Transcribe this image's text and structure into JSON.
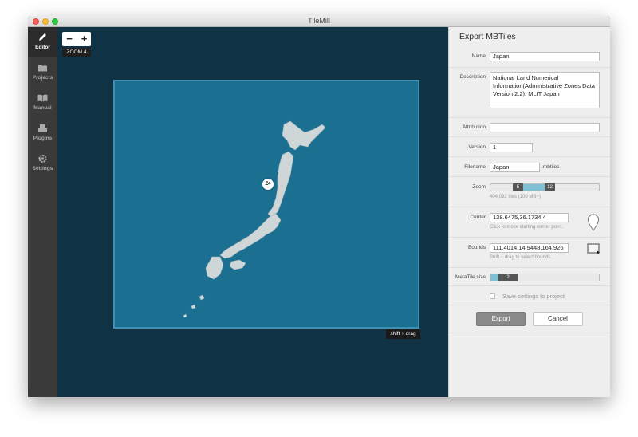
{
  "window": {
    "title": "TileMill"
  },
  "sidebar": {
    "items": [
      {
        "label": "Editor",
        "icon": "pencil-icon",
        "active": true
      },
      {
        "label": "Projects",
        "icon": "folder-icon",
        "active": false
      },
      {
        "label": "Manual",
        "icon": "book-icon",
        "active": false
      },
      {
        "label": "Plugins",
        "icon": "plugin-icon",
        "active": false
      },
      {
        "label": "Settings",
        "icon": "gear-icon",
        "active": false
      }
    ]
  },
  "map": {
    "zoom_in": "+",
    "zoom_out": "−",
    "zoom_level": "ZOOM 4",
    "marker_label": "Z4",
    "hint": "shift + drag"
  },
  "panel": {
    "title": "Export MBTiles",
    "name": {
      "label": "Name",
      "value": "Japan"
    },
    "description": {
      "label": "Description",
      "value": "National Land Numerical Information(Administrative Zones Data Version 2.2), MLIT Japan"
    },
    "attribution": {
      "label": "Attribution",
      "value": ""
    },
    "version": {
      "label": "Version",
      "value": "1"
    },
    "filename": {
      "label": "Filename",
      "value": "Japan",
      "suffix": ".mbtiles"
    },
    "zoom": {
      "label": "Zoom",
      "min": "5",
      "max": "12",
      "hint": "404,092 tiles (100 MB+)"
    },
    "center": {
      "label": "Center",
      "value": "138.6475,36.1734,4",
      "hint": "Click to move starting center point."
    },
    "bounds": {
      "label": "Bounds",
      "value": "111.4014,14.9448,164.926",
      "hint": "Shift + drag to select bounds."
    },
    "metatile": {
      "label": "MetaTile size",
      "value": "2"
    },
    "save_settings": {
      "label": "Save settings to project",
      "checked": false
    },
    "export_button": "Export",
    "cancel_button": "Cancel"
  },
  "colors": {
    "map_bg": "#0f3345",
    "bounds_fill": "#1b6f91",
    "accent": "#7fc1d3"
  }
}
